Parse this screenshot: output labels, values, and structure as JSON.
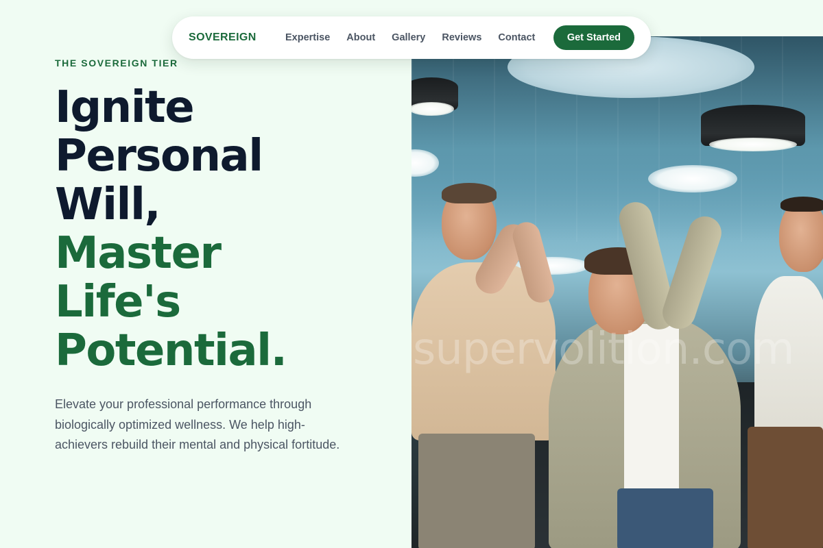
{
  "nav": {
    "brand": "SOVEREIGN",
    "links": [
      "Expertise",
      "About",
      "Gallery",
      "Reviews",
      "Contact"
    ],
    "cta": "Get Started"
  },
  "hero": {
    "eyebrow": "THE SOVEREIGN TIER",
    "headline_dark": [
      "Ignite",
      "Personal",
      "Will,"
    ],
    "headline_green": [
      "Master",
      "Life's",
      "Potential."
    ],
    "lede": "Elevate your professional performance through biologically optimized wellness. We help high-achievers rebuild their mental and physical fortitude.",
    "image_watermark": "supervolition.com"
  },
  "colors": {
    "background": "#f0fcf3",
    "accent": "#1b6a3b",
    "headline_dark": "#0e1a2e",
    "body_text": "#4b5563"
  }
}
